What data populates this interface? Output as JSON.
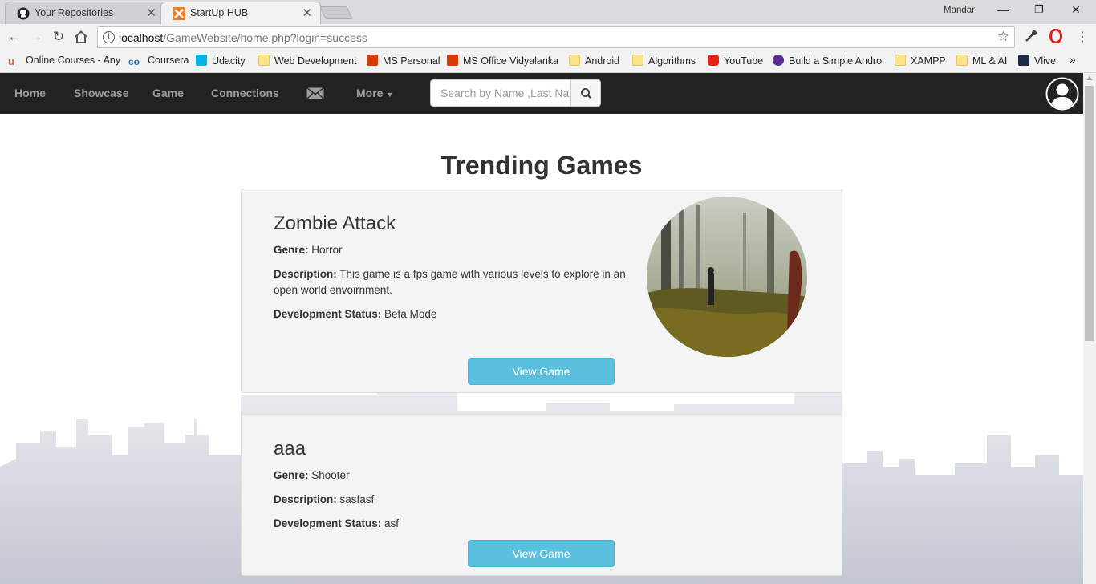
{
  "browser": {
    "tabs": [
      {
        "title": "Your Repositories",
        "icon": "github-icon"
      },
      {
        "title": "StartUp HUB",
        "icon": "xampp-icon",
        "active": true
      }
    ],
    "profile_name": "Mandar",
    "url": {
      "host": "localhost",
      "path": "/GameWebsite/home.php?login=success"
    },
    "bookmarks": [
      {
        "label": "Online Courses - Any",
        "icon": "udemy-icon"
      },
      {
        "label": "Coursera",
        "icon": "coursera-icon"
      },
      {
        "label": "Udacity",
        "icon": "udacity-icon"
      },
      {
        "label": "Web Development",
        "icon": "folder-icon"
      },
      {
        "label": "MS Personal",
        "icon": "office-icon"
      },
      {
        "label": "MS Office Vidyalanka",
        "icon": "office-icon"
      },
      {
        "label": "Android",
        "icon": "folder-icon"
      },
      {
        "label": "Algorithms",
        "icon": "folder-icon"
      },
      {
        "label": "YouTube",
        "icon": "youtube-icon"
      },
      {
        "label": "Build a Simple Andro",
        "icon": "stripe-icon"
      },
      {
        "label": "XAMPP",
        "icon": "folder-icon"
      },
      {
        "label": "ML & AI",
        "icon": "folder-icon"
      },
      {
        "label": "Vlive",
        "icon": "vlive-icon"
      }
    ],
    "more_bookmarks": "»"
  },
  "nav": {
    "links": [
      "Home",
      "Showcase",
      "Game",
      "Connections"
    ],
    "more": "More",
    "search_placeholder": "Search by Name ,Last Na"
  },
  "page": {
    "title": "Trending Games",
    "games": [
      {
        "name": "Zombie Attack",
        "genre_label": "Genre:",
        "genre": "Horror",
        "description_label": "Description:",
        "description": "This game is a fps game with various levels to explore in an open world envoirnment.",
        "status_label": "Development Status:",
        "status": "Beta Mode",
        "button": "View Game"
      },
      {
        "name": "aaa",
        "genre_label": "Genre:",
        "genre": "Shooter",
        "description_label": "Description:",
        "description": "sasfasf",
        "status_label": "Development Status:",
        "status": "asf",
        "button": "View Game"
      }
    ]
  },
  "colors": {
    "navbar": "#222222",
    "button": "#5bc0de",
    "card": "#f4f4f4"
  }
}
